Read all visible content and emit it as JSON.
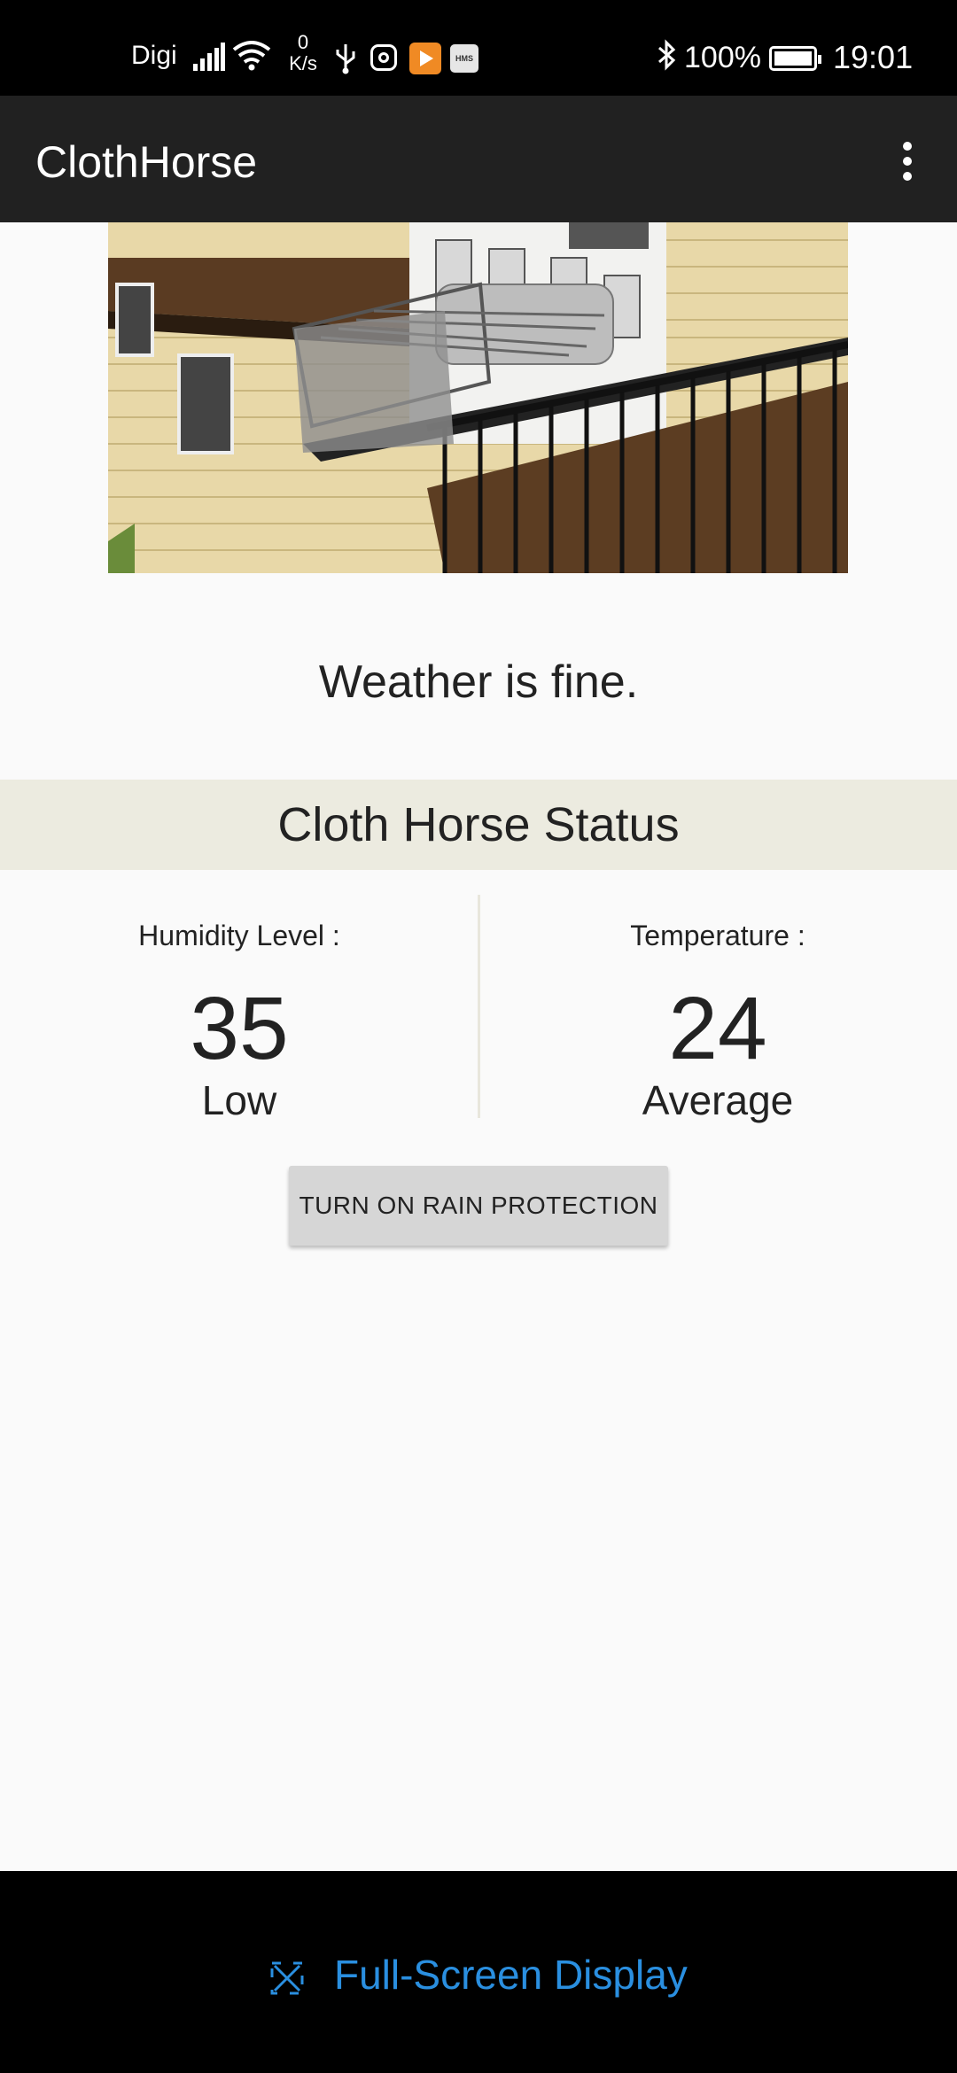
{
  "status_bar": {
    "carrier": "Digi",
    "speed_value": "0",
    "speed_unit": "K/s",
    "hms_badge": "HMS",
    "battery": "100%",
    "time": "19:01"
  },
  "app_bar": {
    "title": "ClothHorse"
  },
  "main": {
    "weather_message": "Weather is fine.",
    "status_header": "Cloth Horse Status",
    "humidity": {
      "label": "Humidity Level :",
      "value": "35",
      "level": "Low"
    },
    "temperature": {
      "label": "Temperature :",
      "value": "24",
      "level": "Average"
    },
    "rain_button_label": "TURN ON RAIN PROTECTION"
  },
  "nav_bar": {
    "full_screen_label": "Full-Screen Display"
  },
  "colors": {
    "app_bar": "#212121",
    "status_header_bg": "#ecebe0",
    "link_blue": "#2a8fe0",
    "button_bg": "#d6d6d6"
  }
}
